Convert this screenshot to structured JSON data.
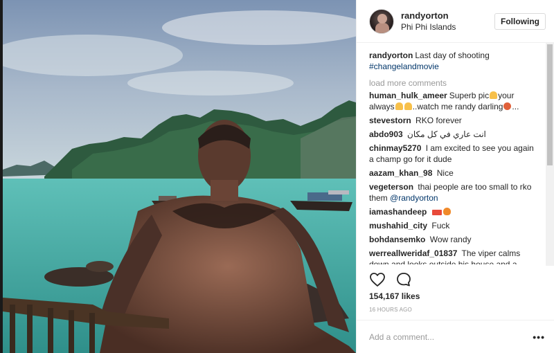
{
  "post": {
    "username": "randyorton",
    "location": "Phi Phi Islands",
    "follow_label": "Following",
    "caption": {
      "user": "randyorton",
      "text": "Last day of shooting",
      "hashtag": "#changelandmovie"
    },
    "load_more_label": "load more comments",
    "comments": [
      {
        "user": "human_hulk_ameer",
        "text_a": "Superb pic",
        "text_b": "your always",
        "text_c": "..watch me randy darling",
        "text_d": "..."
      },
      {
        "user": "stevestorn",
        "text": "RKO forever"
      },
      {
        "user": "abdo903",
        "text": "انت عاري في كل مكان"
      },
      {
        "user": "chinmay5270",
        "text": "I am excited to see you again a champ go for it dude"
      },
      {
        "user": "aazam_khan_98",
        "text": "Nice"
      },
      {
        "user": "vegeterson",
        "text": "thai people are too small to rko them",
        "mention": "@randyorton"
      },
      {
        "user": "iamashandeep",
        "text": ""
      },
      {
        "user": "mushahid_city",
        "text": "Fuck"
      },
      {
        "user": "bohdansemko",
        "text": "Wow randy"
      },
      {
        "user": "werreallweridaf_01837",
        "text": "The viper calms down and looks outside his house and a"
      }
    ],
    "likes": "154,167 likes",
    "timestamp": "16 HOURS AGO",
    "comment_placeholder": "Add a comment...",
    "more_options": "•••"
  },
  "icons": {
    "like": "heart-icon",
    "comment": "comment-icon",
    "more": "more-options-icon"
  }
}
